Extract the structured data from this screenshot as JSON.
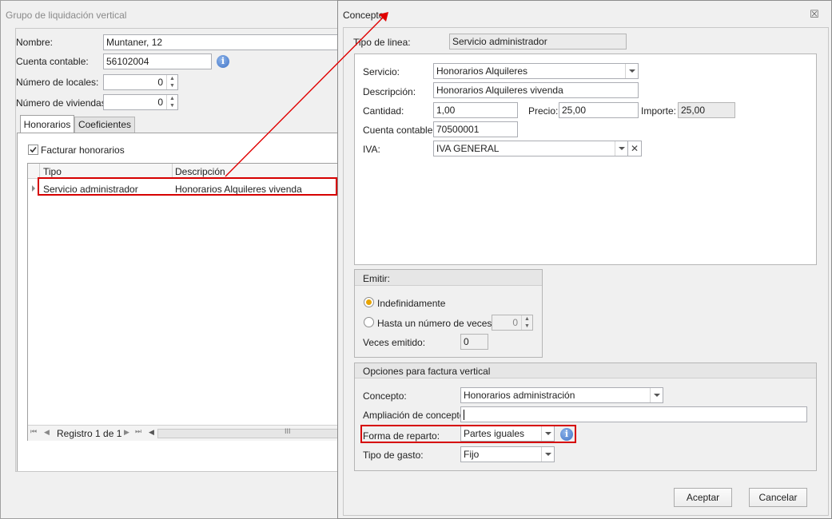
{
  "left_window": {
    "title": "Grupo de liquidación vertical",
    "fields": {
      "nombre_label": "Nombre:",
      "nombre_value": "Muntaner, 12",
      "cuenta_label": "Cuenta contable:",
      "cuenta_value": "56102004",
      "locales_label": "Número de locales:",
      "locales_value": "0",
      "viviendas_label": "Número de viviendas:",
      "viviendas_value": "0"
    },
    "tabs": [
      {
        "label": "Honorarios",
        "active": true
      },
      {
        "label": "Coeficientes",
        "active": false
      }
    ],
    "facturar_label": "Facturar honorarios",
    "facturar_checked": true,
    "grid": {
      "columns": [
        "Tipo",
        "Descripción"
      ],
      "rows": [
        {
          "tipo": "Servicio administrador",
          "descripcion": "Honorarios Alquileres vivenda"
        }
      ]
    },
    "pager": {
      "record_text": "Registro 1 de 1"
    }
  },
  "dialog": {
    "title": "Concepto",
    "tipo_linea_label": "Tipo de linea:",
    "tipo_linea_value": "Servicio administrador",
    "servicio_label": "Servicio:",
    "servicio_value": "Honorarios Alquileres",
    "descripcion_label": "Descripción:",
    "descripcion_value": "Honorarios Alquileres vivenda",
    "cantidad_label": "Cantidad:",
    "cantidad_value": "1,00",
    "precio_label": "Precio:",
    "precio_value": "25,00",
    "importe_label": "Importe:",
    "importe_value": "25,00",
    "cuenta_label": "Cuenta contable:",
    "cuenta_value": "70500001",
    "iva_label": "IVA:",
    "iva_value": "IVA GENERAL",
    "emitir": {
      "title": "Emitir:",
      "option1": "Indefinidamente",
      "option2": "Hasta un número de veces",
      "selected": "Indefinidamente",
      "veces_value": "0",
      "emitido_label": "Veces emitido:",
      "emitido_value": "0"
    },
    "opciones": {
      "title": "Opciones para factura vertical",
      "concepto_label": "Concepto:",
      "concepto_value": "Honorarios administración",
      "ampliacion_label": "Ampliación de concepto:",
      "ampliacion_value": "",
      "forma_label": "Forma de reparto:",
      "forma_value": "Partes iguales",
      "gasto_label": "Tipo de gasto:",
      "gasto_value": "Fijo"
    },
    "aceptar_label": "Aceptar",
    "cancelar_label": "Cancelar"
  },
  "colors": {
    "highlight": "#d60000",
    "panel_bg": "#f0f0f0",
    "border": "#a0a0a0"
  }
}
